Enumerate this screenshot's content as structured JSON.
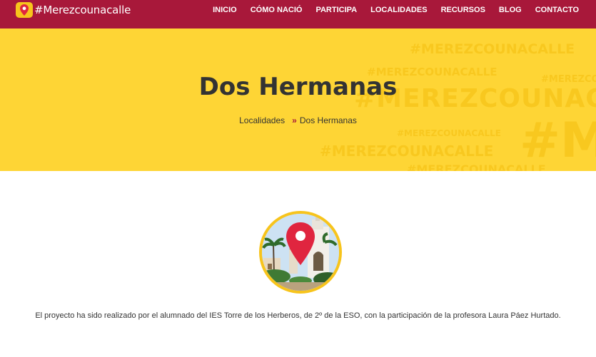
{
  "header": {
    "logo_text": "#Merezcounacalle",
    "nav": [
      "INICIO",
      "CÓMO NACIÓ",
      "PARTICIPA",
      "LOCALIDADES",
      "RECURSOS",
      "BLOG",
      "CONTACTO"
    ]
  },
  "hero": {
    "title": "Dos Hermanas",
    "breadcrumb": {
      "parent": "Localidades",
      "separator": "»",
      "current": "Dos Hermanas"
    },
    "watermark": "#MEREZCOUNACALLE",
    "background_color": "#fed535"
  },
  "avatar": {
    "icon": "map-pin-icon",
    "border_color": "#f7c41c",
    "pin_color": "#e0253f"
  },
  "description": "El proyecto ha sido realizado por el alumnado del IES Torre de los Herberos, de 2º de la ESO, con la participación de la profesora Laura Páez Hurtado.",
  "colors": {
    "brand": "#a8183a",
    "accent": "#f7c41c"
  }
}
